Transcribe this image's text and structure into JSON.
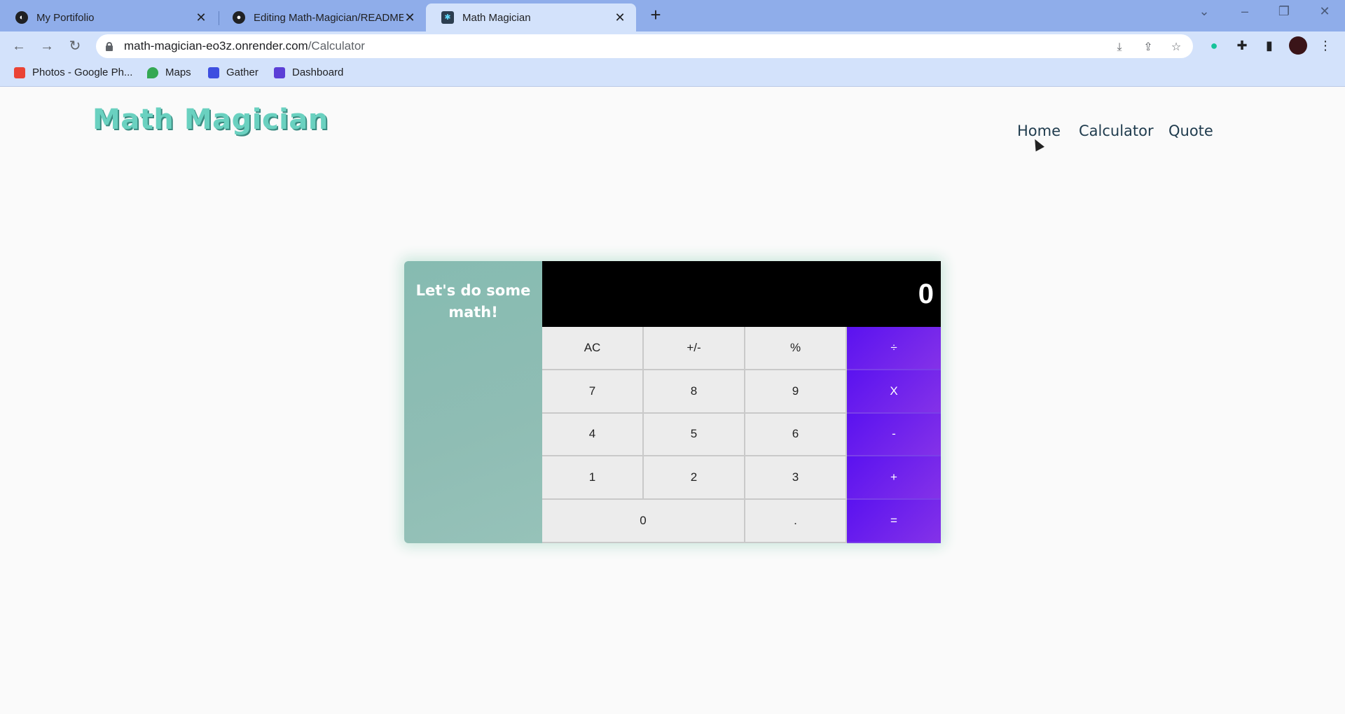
{
  "browser": {
    "tabs": [
      {
        "title": "My Portifolio",
        "favicon": "globe-icon"
      },
      {
        "title": "Editing Math-Magician/README",
        "favicon": "github-icon"
      },
      {
        "title": "Math Magician",
        "favicon": "react-icon"
      }
    ],
    "url_host": "math-magician-eo3z.onrender.com",
    "url_path": "/Calculator",
    "bookmarks": [
      {
        "label": "Photos - Google Ph...",
        "color": "#ea4335"
      },
      {
        "label": "Maps",
        "color": "#34a853"
      },
      {
        "label": "Gather",
        "color": "#3d4fe0"
      },
      {
        "label": "Dashboard",
        "color": "#5b3fd6"
      }
    ]
  },
  "page": {
    "logo": "Math Magician",
    "nav": [
      "Home",
      "Calculator",
      "Quote"
    ]
  },
  "calculator": {
    "intro": "Let's do some math!",
    "display": "0",
    "keys": {
      "ac": "AC",
      "sign": "+/-",
      "percent": "%",
      "divide": "÷",
      "seven": "7",
      "eight": "8",
      "nine": "9",
      "multiply": "X",
      "four": "4",
      "five": "5",
      "six": "6",
      "minus": "-",
      "one": "1",
      "two": "2",
      "three": "3",
      "plus": "+",
      "zero": "0",
      "dot": ".",
      "equals": "="
    },
    "colors": {
      "accent": "#5a12f0",
      "panel": "#86bbb1",
      "logo": "#6ad1c0"
    }
  }
}
